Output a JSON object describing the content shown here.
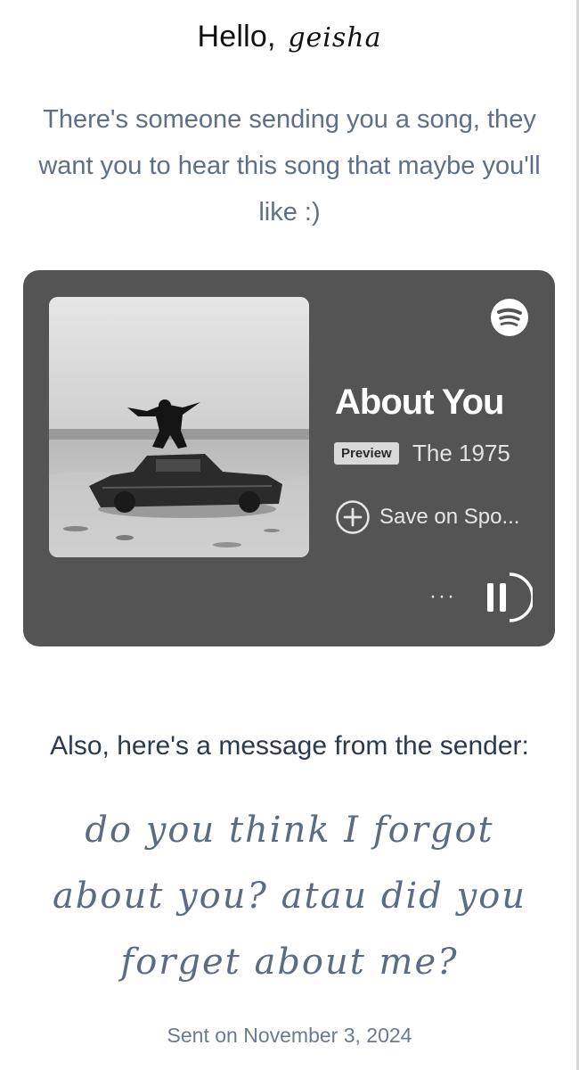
{
  "greeting": {
    "hello": "Hello,",
    "name": "geisha"
  },
  "intro_text": "There's someone sending you a song, they want you to hear this song that maybe you'll like :)",
  "player": {
    "track_title": "About You",
    "badge": "Preview",
    "artist": "The 1975",
    "save_label": "Save on Spo...",
    "more_label": "···",
    "logo_icon": "spotify-logo-icon",
    "save_icon": "plus-circle-icon",
    "play_state_icon": "pause-icon",
    "card_color": "#545454"
  },
  "message_section": {
    "heading": "Also, here's a message from the sender:",
    "message": "do you think I forgot about you? atau did you forget about me?",
    "sent_date": "Sent on November 3, 2024"
  },
  "colors": {
    "intro_text": "#5f6f87",
    "message_text": "#5b6b84",
    "heading_text": "#2d3a4d"
  }
}
